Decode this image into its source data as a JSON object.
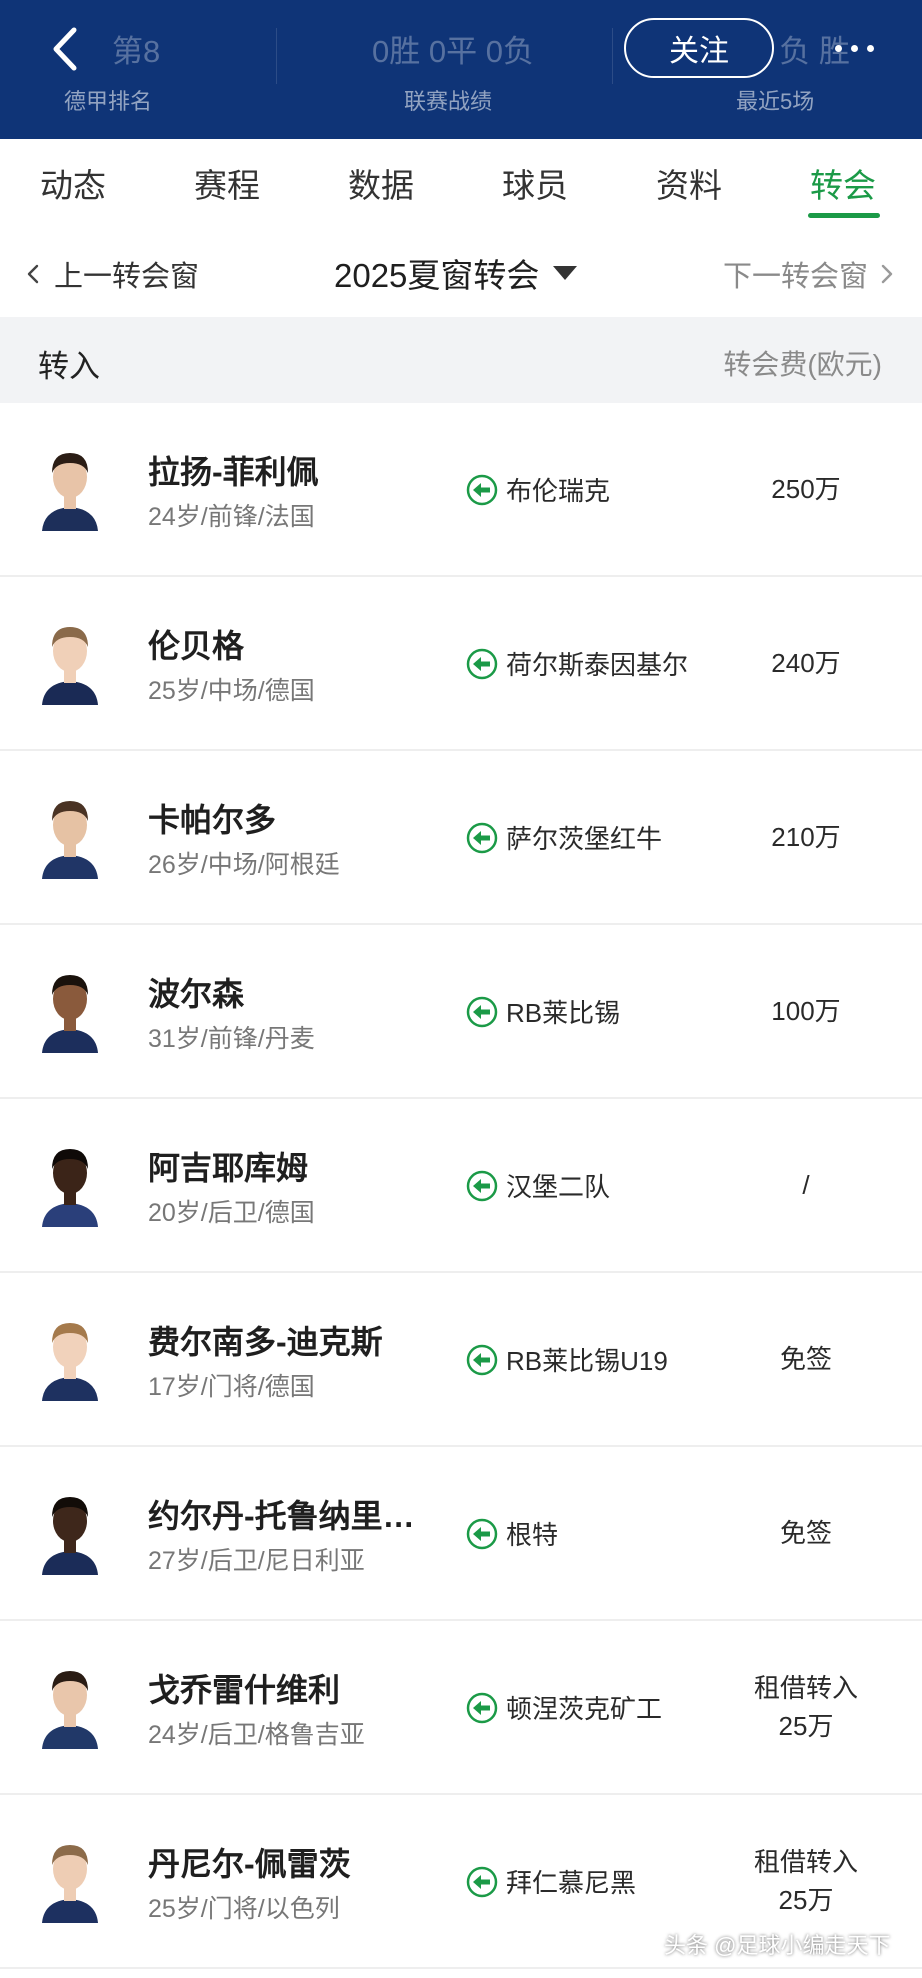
{
  "header": {
    "left_value": "第8",
    "left_label": "德甲排名",
    "center_value": "0胜 0平 0负",
    "center_label": "联赛战绩",
    "right_value": "负 负 负 胜",
    "right_label": "最近5场",
    "follow_label": "关注"
  },
  "tabs": [
    {
      "label": "动态"
    },
    {
      "label": "赛程"
    },
    {
      "label": "数据"
    },
    {
      "label": "球员"
    },
    {
      "label": "资料"
    },
    {
      "label": "转会",
      "active": true
    }
  ],
  "window_nav": {
    "prev_label": "上一转会窗",
    "current": "2025夏窗转会",
    "next_label": "下一转会窗"
  },
  "section": {
    "title": "转入",
    "fee_header": "转会费(欧元)"
  },
  "colors": {
    "header_bg": "#0f3477",
    "accent_green": "#1b9a47",
    "section_bg": "#f2f3f5"
  },
  "transfers": [
    {
      "name": "拉扬-菲利佩",
      "info": "24岁/前锋/法国",
      "from": "布伦瑞克",
      "fee": [
        "250万"
      ]
    },
    {
      "name": "伦贝格",
      "info": "25岁/中场/德国",
      "from": "荷尔斯泰因基尔",
      "fee": [
        "240万"
      ]
    },
    {
      "name": "卡帕尔多",
      "info": "26岁/中场/阿根廷",
      "from": "萨尔茨堡红牛",
      "fee": [
        "210万"
      ]
    },
    {
      "name": "波尔森",
      "info": "31岁/前锋/丹麦",
      "from": "RB莱比锡",
      "fee": [
        "100万"
      ]
    },
    {
      "name": "阿吉耶库姆",
      "info": "20岁/后卫/德国",
      "from": "汉堡二队",
      "fee": [
        "/"
      ]
    },
    {
      "name": "费尔南多-迪克斯",
      "info": "17岁/门将/德国",
      "from": "RB莱比锡U19",
      "fee": [
        "免签"
      ]
    },
    {
      "name": "约尔丹-托鲁纳里…",
      "info": "27岁/后卫/尼日利亚",
      "from": "根特",
      "fee": [
        "免签"
      ]
    },
    {
      "name": "戈乔雷什维利",
      "info": "24岁/后卫/格鲁吉亚",
      "from": "顿涅茨克矿工",
      "fee": [
        "租借转入",
        "25万"
      ]
    },
    {
      "name": "丹尼尔-佩雷茨",
      "info": "25岁/门将/以色列",
      "from": "拜仁慕尼黑",
      "fee": [
        "租借转入",
        "25万"
      ]
    }
  ],
  "watermark": "头条 @足球小编走天下"
}
